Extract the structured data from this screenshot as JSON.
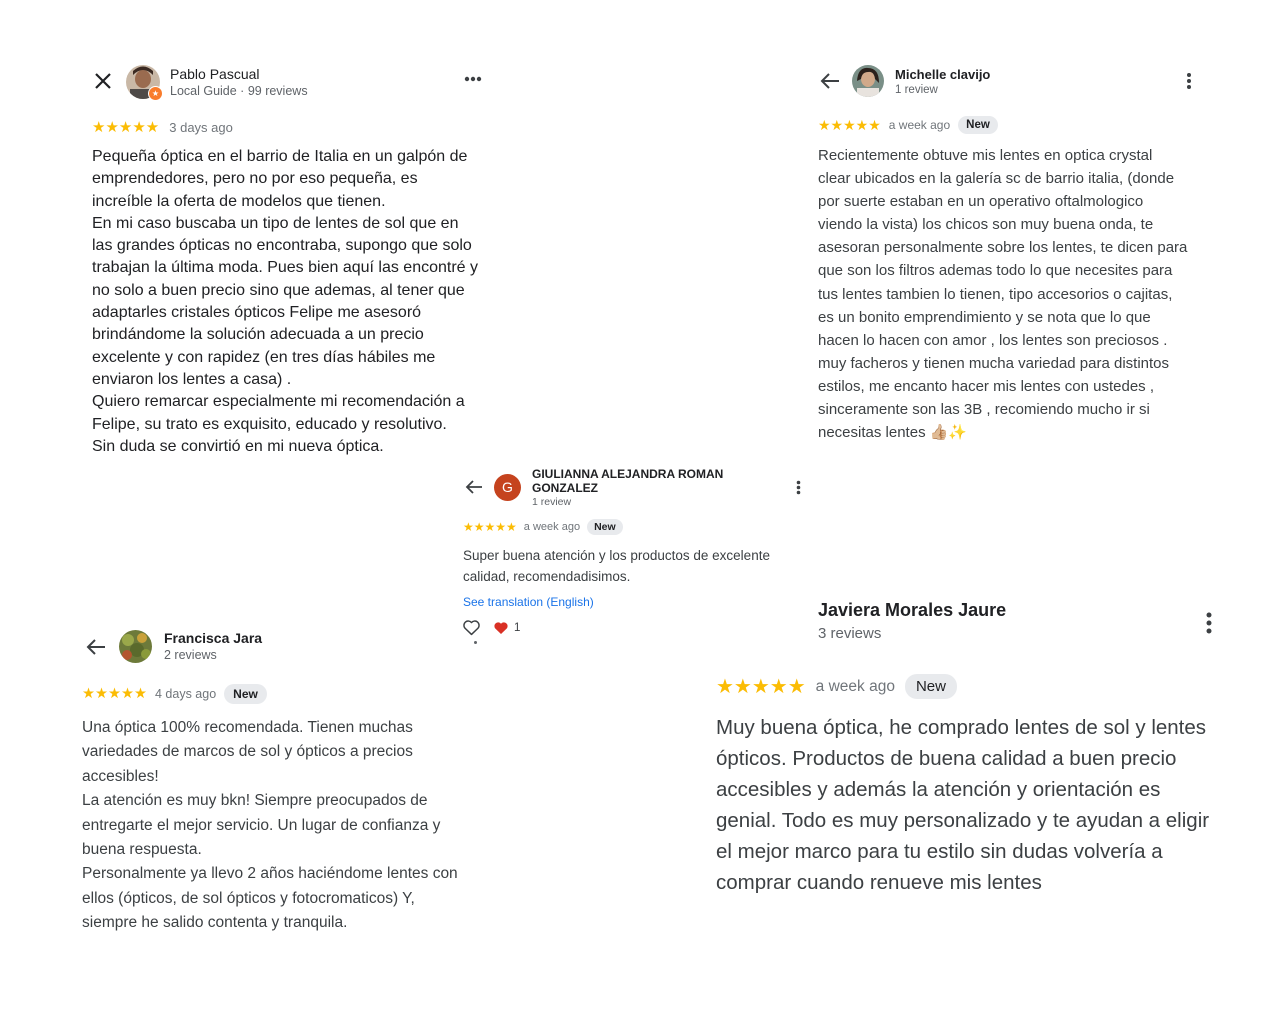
{
  "reviews": [
    {
      "author": "Pablo Pascual",
      "subtitle": "Local Guide · 99 reviews",
      "stars": "★★★★★",
      "rating": 5,
      "time_ago": "3 days ago",
      "text": "Pequeña óptica en el barrio de Italia en un galpón de\nemprendedores, pero no por eso pequeña, es\nincreíble la oferta de modelos que tienen.\nEn mi caso buscaba un tipo de lentes de sol que en\nlas grandes ópticas no encontraba, supongo que solo\ntrabajan la última moda. Pues bien aquí las encontré y\nno solo a buen precio sino que ademas, al tener que\nadaptarles cristales ópticos Felipe me asesoró\nbrindándome la solución adecuada a un precio\nexcelente y con rapidez (en tres días hábiles me\nenviaron los lentes a casa) .\nQuiero remarcar especialmente mi recomendación a\nFelipe, su trato es exquisito, educado y resolutivo.\nSin duda se convirtió en mi nueva óptica."
    },
    {
      "author": "Michelle clavijo",
      "subtitle": "1 review",
      "stars": "★★★★★",
      "rating": 5,
      "time_ago": "a week ago",
      "badge": "New",
      "text": "Recientemente obtuve mis lentes en optica crystal\nclear ubicados en la galería sc de barrio italia, (donde\npor suerte estaban en un operativo oftalmologico\nviendo la vista) los chicos son muy buena onda, te\nasesoran personalmente sobre los lentes, te dicen para\nque son los filtros ademas todo lo que necesites para\ntus lentes tambien lo tienen, tipo accesorios o cajitas,\nes un bonito emprendimiento y se nota que lo que\nhacen lo hacen con amor , los lentes son preciosos .\nmuy facheros y tienen mucha variedad para distintos\nestilos, me encanto hacer mis lentes con ustedes ,\nsinceramente son las 3B , recomiendo mucho ir si\nnecesitas lentes 👍🏼✨"
    },
    {
      "author": "GIULIANNA ALEJANDRA ROMAN GONZALEZ",
      "initial": "G",
      "subtitle": "1 review",
      "stars": "★★★★★",
      "rating": 5,
      "time_ago": "a week ago",
      "badge": "New",
      "text": "Super buena atención y los productos de excelente\ncalidad, recomendadisimos.",
      "translate_link": "See translation (English)",
      "reaction_count": "1"
    },
    {
      "author": "Francisca Jara",
      "subtitle": "2 reviews",
      "stars": "★★★★★",
      "rating": 5,
      "time_ago": "4 days ago",
      "badge": "New",
      "text": "Una óptica 100% recomendada. Tienen muchas\nvariedades de marcos de sol y ópticos a precios\naccesibles!\nLa atención es muy bkn! Siempre preocupados de\nentregarte el mejor servicio. Un lugar de confianza y\nbuena respuesta.\nPersonalmente ya llevo 2 años haciéndome lentes con\nellos (ópticos, de sol ópticos y fotocromaticos) Y,\nsiempre he salido contenta y tranquila."
    },
    {
      "author": "Javiera Morales Jaure",
      "subtitle": "3 reviews",
      "stars": "★★★★★",
      "rating": 5,
      "time_ago": "a week ago",
      "badge": "New",
      "text": "Muy buena óptica, he comprado lentes de sol y lentes\nópticos. Productos de buena calidad a buen precio\naccesibles y además la atención y orientación es\ngenial. Todo es muy personalizado y te ayudan a eligir\nel mejor marco para tu estilo sin dudas volvería a\ncomprar cuando renueve mis lentes"
    }
  ],
  "colors": {
    "star": "#fbbc04",
    "link": "#1a73e8",
    "badge_bg": "#e8eaed",
    "avatar_g": "#c5431e",
    "heart": "#d93025"
  },
  "icons": [
    "close-icon",
    "back-arrow-icon",
    "more-vert-icon",
    "more-horiz-icon",
    "heart-outline-icon",
    "heart-filled-icon",
    "local-guide-badge-icon"
  ]
}
